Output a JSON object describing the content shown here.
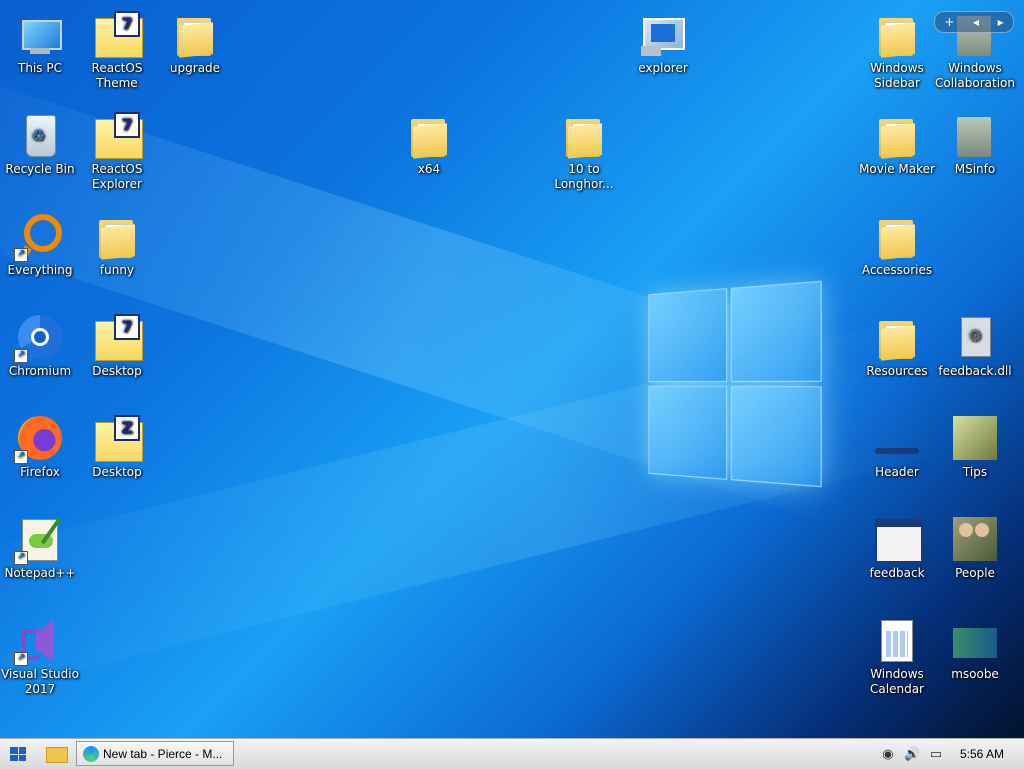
{
  "desktop": {
    "icons": {
      "this_pc": "This PC",
      "recycle_bin": "Recycle Bin",
      "everything": "Everything",
      "chromium": "Chromium",
      "firefox": "Firefox",
      "notepadpp": "Notepad++",
      "visual_studio": "Visual Studio 2017",
      "reactos_theme": "ReactOS Theme",
      "reactos_explorer": "ReactOS Explorer",
      "funny": "funny",
      "desktop_1": "Desktop",
      "desktop_2": "Desktop",
      "upgrade": "upgrade",
      "x64": "x64",
      "longhorn": "10 to Longhor...",
      "explorer": "explorer",
      "windows_sidebar": "Windows Sidebar",
      "windows_collaboration": "Windows Collaboration",
      "movie_maker": "Movie Maker",
      "msinfo": "MSinfo",
      "accessories": "Accessories",
      "resources": "Resources",
      "feedback_dll": "feedback.dll",
      "header": "Header",
      "tips": "Tips",
      "feedback": "feedback",
      "people": "People",
      "windows_calendar": "Windows Calendar",
      "msoobe": "msoobe"
    },
    "badges": {
      "seven": "7",
      "zed": "Z"
    },
    "widget": {
      "add": "+",
      "prev": "◂",
      "next": "▸"
    }
  },
  "taskbar": {
    "start_icon": "windows-logo",
    "task": {
      "label": "New tab - Pierce - M..."
    },
    "tray": {
      "network": "◉",
      "volume": "🔊",
      "monitor": "▭",
      "time": "5:56 AM"
    }
  },
  "colors": {
    "accent": "#1b5fc9",
    "desktop": "#0b74df",
    "taskbar": "#e6e6e6"
  }
}
